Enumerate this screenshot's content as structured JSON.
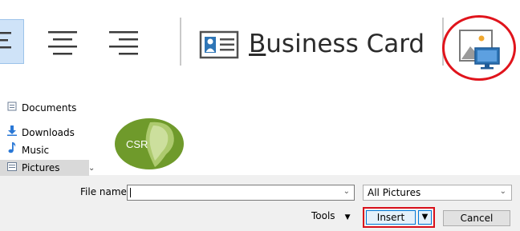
{
  "ribbon": {
    "business_card_label_first": "B",
    "business_card_label_rest": "usiness Card"
  },
  "dialog": {
    "nav": {
      "items": [
        {
          "label": "Documents",
          "icon": "documents-icon"
        },
        {
          "label": "Downloads",
          "icon": "downloads-icon"
        },
        {
          "label": "Music",
          "icon": "music-icon"
        },
        {
          "label": "Pictures",
          "icon": "pictures-icon",
          "selected": true
        }
      ]
    },
    "preview": {
      "thumbnail_text": "CSR"
    },
    "file_name": {
      "label": "File name:",
      "value": ""
    },
    "filter": {
      "selected": "All Pictures"
    },
    "tools_label": "Tools",
    "insert_label": "Insert",
    "cancel_label": "Cancel"
  },
  "colors": {
    "highlight_red": "#e0141c",
    "logo_green": "#6f9a2b",
    "selection_blue": "#cfe3f8"
  }
}
